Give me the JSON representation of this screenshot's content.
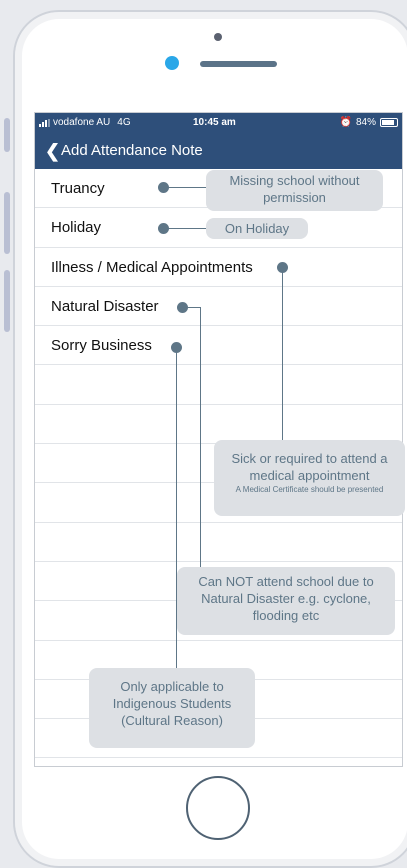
{
  "status_bar": {
    "carrier": "vodafone AU",
    "network": "4G",
    "time": "10:45 am",
    "battery": "84%",
    "battery_level": 0.84
  },
  "nav": {
    "title": "Add Attendance Note"
  },
  "list_items": [
    {
      "label": "Truancy"
    },
    {
      "label": "Holiday"
    },
    {
      "label": "Illness / Medical Appointments"
    },
    {
      "label": "Natural Disaster"
    },
    {
      "label": "Sorry Business"
    }
  ],
  "annotations": {
    "truancy": "Missing school without permission",
    "holiday": "On Holiday",
    "illness_main": "Sick or required to attend a medical appointment",
    "illness_small": "A Medical Certificate should be presented",
    "natural_disaster": "Can NOT attend school due to Natural Disaster e.g. cyclone, flooding etc",
    "sorry_business": "Only applicable to Indigenous Students (Cultural Reason)"
  },
  "colors": {
    "nav_background": "#2e4f7a",
    "annotation_text": "#5e7687",
    "annotation_bubble": "#dde0e4",
    "sensor": "#2aa7e8"
  }
}
